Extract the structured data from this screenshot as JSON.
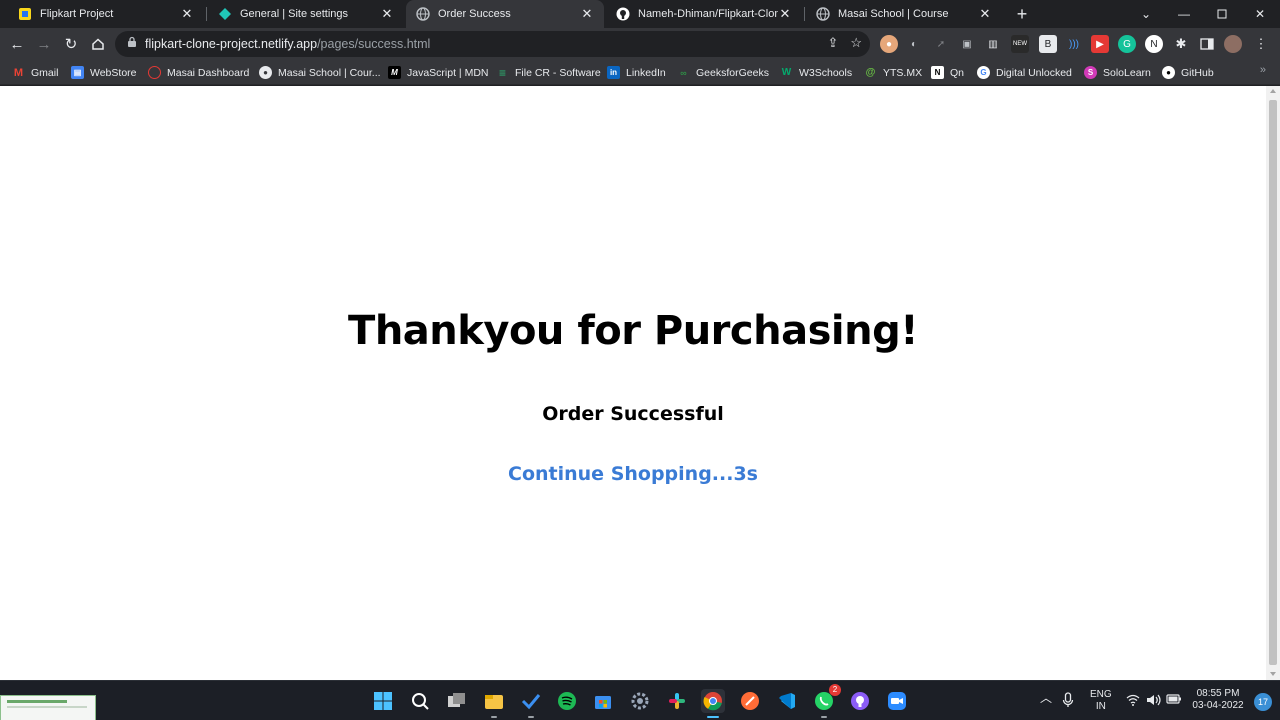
{
  "browser": {
    "tabs": [
      {
        "title": "Flipkart Project",
        "favicon": "flipkart-icon",
        "active": false
      },
      {
        "title": "General | Site settings",
        "favicon": "netlify-icon",
        "active": false
      },
      {
        "title": "Order Success",
        "favicon": "globe-icon",
        "active": true
      },
      {
        "title": "Nameh-Dhiman/Flipkart-Clone-P",
        "favicon": "github-icon",
        "active": false
      },
      {
        "title": "Masai School | Course",
        "favicon": "globe-icon",
        "active": false
      }
    ],
    "address": {
      "host": "flipkart-clone-project.netlify.app",
      "path": "/pages/success.html"
    },
    "bookmarks": [
      {
        "label": "Gmail",
        "icon": "gmail-icon",
        "color": "#ea4335"
      },
      {
        "label": "WebStore",
        "icon": "webstore-icon",
        "color": "#4285f4"
      },
      {
        "label": "Masai Dashboard",
        "icon": "masai-icon",
        "color": "#e53935"
      },
      {
        "label": "Masai School | Cour...",
        "icon": "globe-icon",
        "color": "#9aa0a6"
      },
      {
        "label": "JavaScript | MDN",
        "icon": "mdn-icon",
        "color": "#000000"
      },
      {
        "label": "File CR - Software",
        "icon": "filecr-icon",
        "color": "#2bb673"
      },
      {
        "label": "LinkedIn",
        "icon": "linkedin-icon",
        "color": "#0a66c2"
      },
      {
        "label": "GeeksforGeeks",
        "icon": "gfg-icon",
        "color": "#2f8d46"
      },
      {
        "label": "W3Schools",
        "icon": "w3schools-icon",
        "color": "#04aa6d"
      },
      {
        "label": "YTS.MX",
        "icon": "yts-icon",
        "color": "#6ac045"
      },
      {
        "label": "Qn",
        "icon": "notion-icon",
        "color": "#ffffff"
      },
      {
        "label": "Digital Unlocked",
        "icon": "google-icon",
        "color": "#4285f4"
      },
      {
        "label": "SoloLearn",
        "icon": "sololearn-icon",
        "color": "#d23ab8"
      },
      {
        "label": "GitHub",
        "icon": "github-icon",
        "color": "#ffffff"
      }
    ]
  },
  "page": {
    "heading": "Thankyou for Purchasing!",
    "subheading": "Order Successful",
    "continue_link": "Continue Shopping...3s",
    "link_color": "#3a7bd5"
  },
  "taskbar": {
    "lang_top": "ENG",
    "lang_bottom": "IN",
    "time": "08:55 PM",
    "date": "03-04-2022",
    "notification_count": "17",
    "whatsapp_badge": "2"
  }
}
